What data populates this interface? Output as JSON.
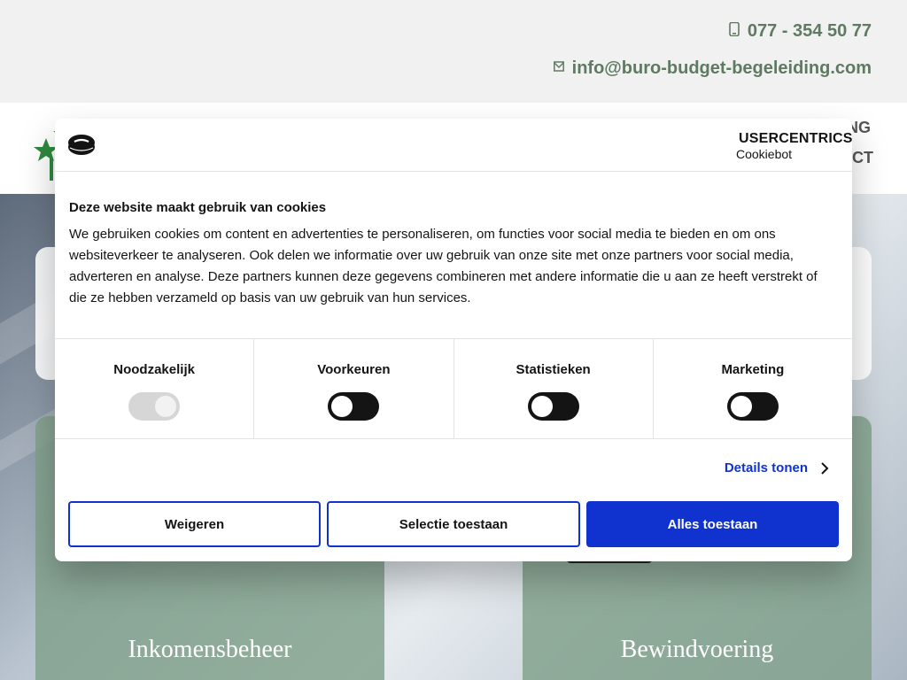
{
  "contact": {
    "phone_icon": "phone-icon",
    "phone": "077 - 354 50 77",
    "email_icon": "envelope-icon",
    "email": "info@buro-budget-begeleiding.com"
  },
  "nav": {
    "item_right_top": "NG",
    "item_right_bottom": "CT"
  },
  "tiles": {
    "left_label": "Inkomensbeheer",
    "right_label": "Bewindvoering"
  },
  "cookie_dialog": {
    "brand_name": "USERCENTRICS",
    "brand_product": "Cookiebot",
    "title": "Deze website maakt gebruik van cookies",
    "text": "We gebruiken cookies om content en advertenties te personaliseren, om functies voor social media te bieden en om ons websiteverkeer te analyseren. Ook delen we informatie over uw gebruik van onze site met onze partners voor social media, adverteren en analyse. Deze partners kunnen deze gegevens combineren met andere informatie die u aan ze heeft verstrekt of die ze hebben verzameld op basis van uw gebruik van hun services.",
    "categories": [
      {
        "label": "Noodzakelijk",
        "enabled": true,
        "locked": true
      },
      {
        "label": "Voorkeuren",
        "enabled": false,
        "locked": false
      },
      {
        "label": "Statistieken",
        "enabled": false,
        "locked": false
      },
      {
        "label": "Marketing",
        "enabled": false,
        "locked": false
      }
    ],
    "details_label": "Details tonen",
    "buttons": {
      "reject": "Weigeren",
      "allow_selection": "Selectie toestaan",
      "allow_all": "Alles toestaan"
    },
    "colors": {
      "accent": "#1032cf",
      "text": "#141414"
    }
  },
  "colors": {
    "brand_green": "#5f7a63",
    "tile_green": "#80a08a"
  }
}
